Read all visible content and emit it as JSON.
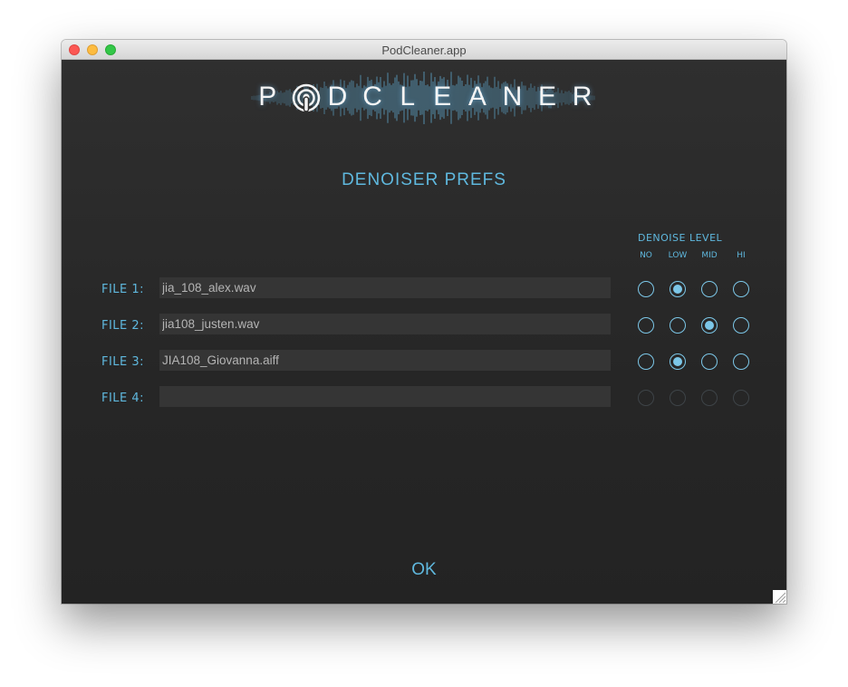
{
  "window": {
    "title": "PodCleaner.app"
  },
  "logo": {
    "text": "PODCLEANER"
  },
  "heading": "DENOISER PREFS",
  "denoise": {
    "label": "DENOISE LEVEL",
    "levels": [
      "NO",
      "LOW",
      "MID",
      "HI"
    ]
  },
  "files": [
    {
      "label": "FILE 1:",
      "value": "jia_108_alex.wav",
      "selected": "LOW"
    },
    {
      "label": "FILE 2:",
      "value": "jia108_justen.wav",
      "selected": "MID"
    },
    {
      "label": "FILE 3:",
      "value": "JIA108_Giovanna.aiff",
      "selected": "LOW"
    },
    {
      "label": "FILE 4:",
      "value": "",
      "selected": ""
    }
  ],
  "ok_label": "OK",
  "colors": {
    "accent": "#5fb8de",
    "background": "#2b2b2b",
    "field": "#353535"
  }
}
